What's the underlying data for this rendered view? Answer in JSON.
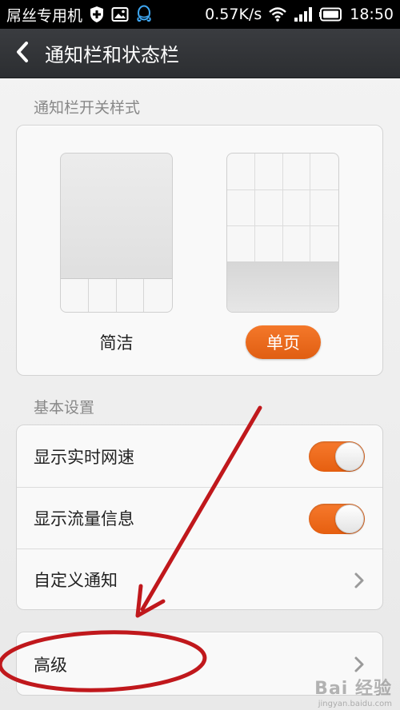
{
  "status_bar": {
    "carrier": "屌丝专用机",
    "speed": "0.57K/s",
    "time": "18:50",
    "icons": [
      "shield-plus-icon",
      "image-icon",
      "qq-icon",
      "wifi-icon",
      "signal-icon",
      "battery-icon"
    ]
  },
  "header": {
    "back_icon": "back-arrow-icon",
    "title": "通知栏和状态栏"
  },
  "notification_style": {
    "section_label": "通知栏开关样式",
    "options": [
      {
        "label": "简洁",
        "selected": false
      },
      {
        "label": "单页",
        "selected": true
      }
    ]
  },
  "basic_settings": {
    "section_label": "基本设置",
    "items": [
      {
        "label": "显示实时网速",
        "control": "toggle",
        "on": true
      },
      {
        "label": "显示流量信息",
        "control": "toggle",
        "on": true
      },
      {
        "label": "自定义通知",
        "control": "chevron"
      }
    ]
  },
  "advanced": {
    "label": "高级",
    "control": "chevron"
  },
  "watermark": {
    "main": "Bai 经验",
    "sub": "jingyan.baidu.com"
  },
  "colors": {
    "accent": "#ee6a1c",
    "annotation": "#c0181c",
    "title_bar": "#33363a"
  }
}
